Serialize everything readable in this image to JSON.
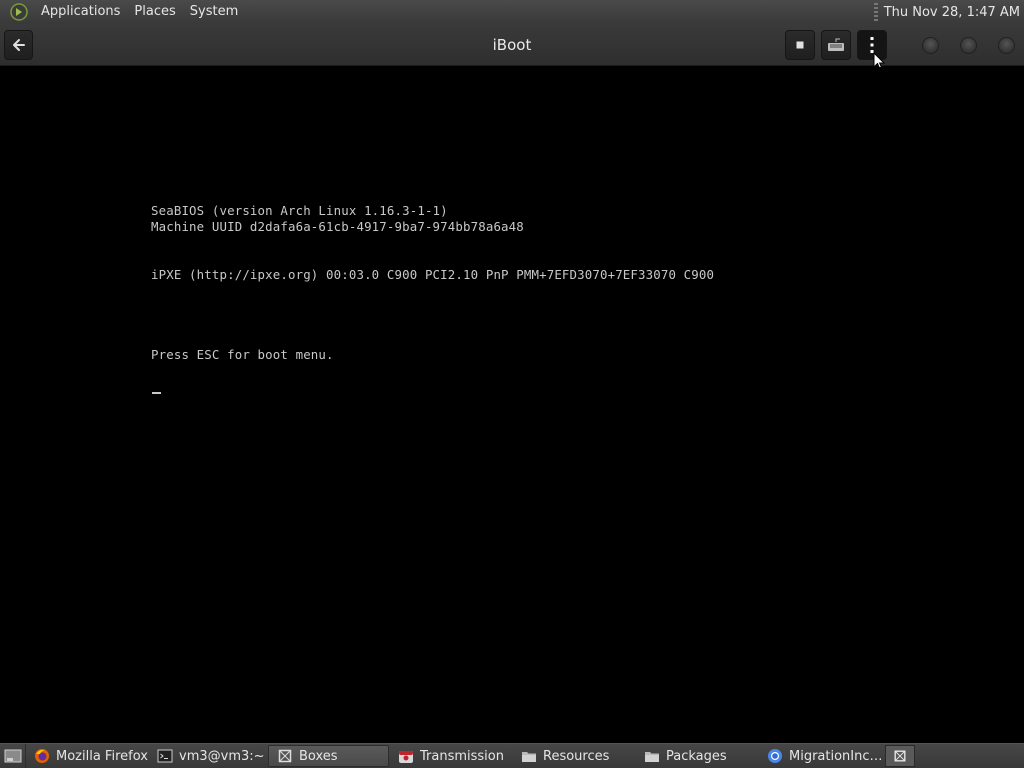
{
  "top_panel": {
    "menus": [
      "Applications",
      "Places",
      "System"
    ],
    "clock": "Thu Nov 28,  1:47 AM"
  },
  "window": {
    "title": "iBoot",
    "buttons": {
      "back": "back-icon",
      "stop": "stop-icon",
      "keyboard": "keyboard-icon",
      "menu": "kebab-menu-icon"
    },
    "controls": [
      "minimize",
      "maximize",
      "close"
    ]
  },
  "console": {
    "lines": [
      "SeaBIOS (version Arch Linux 1.16.3-1-1)",
      "Machine UUID d2dafa6a-61cb-4917-9ba7-974bb78a6a48",
      "iPXE (http://ipxe.org) 00:03.0 C900 PCI2.10 PnP PMM+7EFD3070+7EF33070 C900",
      "Press ESC for boot menu."
    ],
    "cursor": "_"
  },
  "taskbar": {
    "tasks": [
      {
        "label": "Mozilla Firefox",
        "icon": "firefox-icon"
      },
      {
        "label": "vm3@vm3:~",
        "icon": "terminal-icon"
      },
      {
        "label": "Boxes",
        "icon": "boxes-icon",
        "active": true
      },
      {
        "label": "Transmission",
        "icon": "transmission-icon"
      },
      {
        "label": "Resources",
        "icon": "folder-icon"
      },
      {
        "label": "Packages",
        "icon": "folder-icon"
      },
      {
        "label": "MigrationInc…",
        "icon": "chrome-icon"
      }
    ]
  },
  "colors": {
    "panel": "#404040",
    "headerbar": "#333333",
    "console_bg": "#000000",
    "console_text": "#c8c8c8"
  }
}
